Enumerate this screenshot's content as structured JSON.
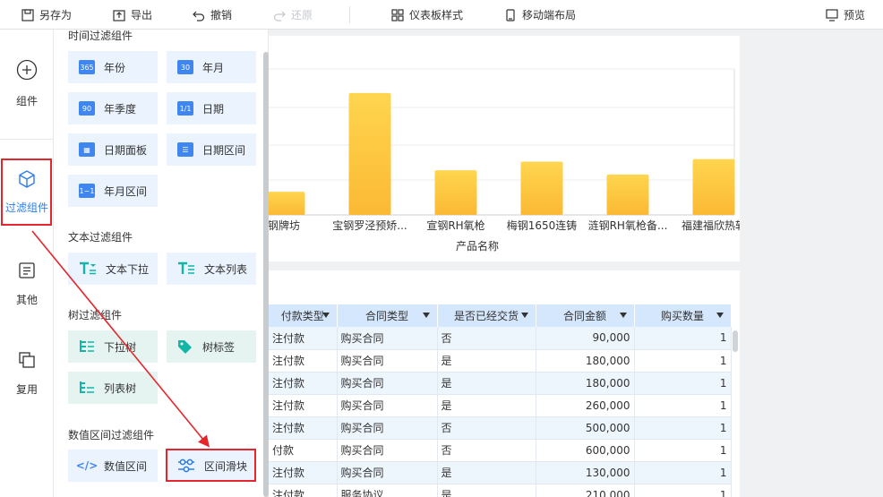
{
  "toolbar": {
    "save_as": "另存为",
    "export": "导出",
    "undo": "撤销",
    "redo": "还原",
    "dashboard_style": "仪表板样式",
    "mobile_layout": "移动端布局",
    "preview": "预览"
  },
  "rail": {
    "components": "组件",
    "filter_components": "过滤组件",
    "other": "其他",
    "reuse": "复用"
  },
  "panel": {
    "time_section": "时间过滤组件",
    "time_items": [
      "年份",
      "年月",
      "年季度",
      "日期",
      "日期面板",
      "日期区间",
      "年月区间"
    ],
    "time_icons": [
      "365",
      "30",
      "90",
      "1/1",
      "▦",
      "☰",
      "1~1"
    ],
    "text_section": "文本过滤组件",
    "text_items": [
      "文本下拉",
      "文本列表"
    ],
    "tree_section": "树过滤组件",
    "tree_items": [
      "下拉树",
      "树标签",
      "列表树"
    ],
    "numeric_section": "数值区间过滤组件",
    "numeric_items": [
      "数值区间",
      "区间滑块"
    ]
  },
  "chart_data": {
    "type": "bar",
    "xlabel": "产品名称",
    "categories": [
      "钢牌坊",
      "宝钢罗泾预矫...",
      "宣钢RH氧枪",
      "梅钢1650连铸",
      "涟钢RH氧枪备...",
      "福建福欣热轧"
    ],
    "values": [
      27,
      142,
      52,
      62,
      47,
      65
    ],
    "ylim": [
      0,
      170
    ],
    "color_top": "#ffd54f",
    "color_bottom": "#fbb934"
  },
  "table": {
    "headers": [
      "付款类型",
      "合同类型",
      "是否已经交货",
      "合同金额",
      "购买数量"
    ],
    "rows": [
      [
        "注付款",
        "购买合同",
        "否",
        "90,000",
        "1"
      ],
      [
        "注付款",
        "购买合同",
        "是",
        "180,000",
        "1"
      ],
      [
        "注付款",
        "购买合同",
        "是",
        "180,000",
        "1"
      ],
      [
        "注付款",
        "购买合同",
        "是",
        "260,000",
        "1"
      ],
      [
        "注付款",
        "购买合同",
        "否",
        "500,000",
        "1"
      ],
      [
        "付款",
        "购买合同",
        "否",
        "600,000",
        "1"
      ],
      [
        "注付款",
        "购买合同",
        "是",
        "130,000",
        "1"
      ],
      [
        "注付款",
        "服务协议",
        "是",
        "210,000",
        "1"
      ]
    ]
  },
  "colors": {
    "accent": "#2f7ded",
    "highlight": "#e5262c"
  }
}
